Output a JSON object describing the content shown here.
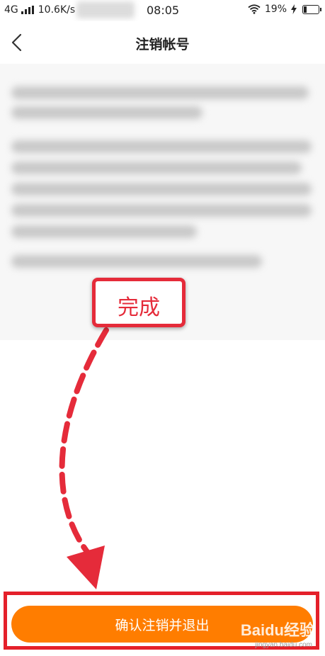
{
  "status_bar": {
    "network_type": "4G",
    "speed": "10.6K/s",
    "time": "08:05",
    "battery": "19%"
  },
  "nav": {
    "title": "注销帐号"
  },
  "annotation": {
    "label": "完成",
    "color": "#e52b3a"
  },
  "footer": {
    "confirm_label": "确认注销并退出",
    "button_color": "#ff7d00"
  },
  "watermark": {
    "brand": "Baidu经验",
    "url": "jingyan.baidu.com"
  }
}
